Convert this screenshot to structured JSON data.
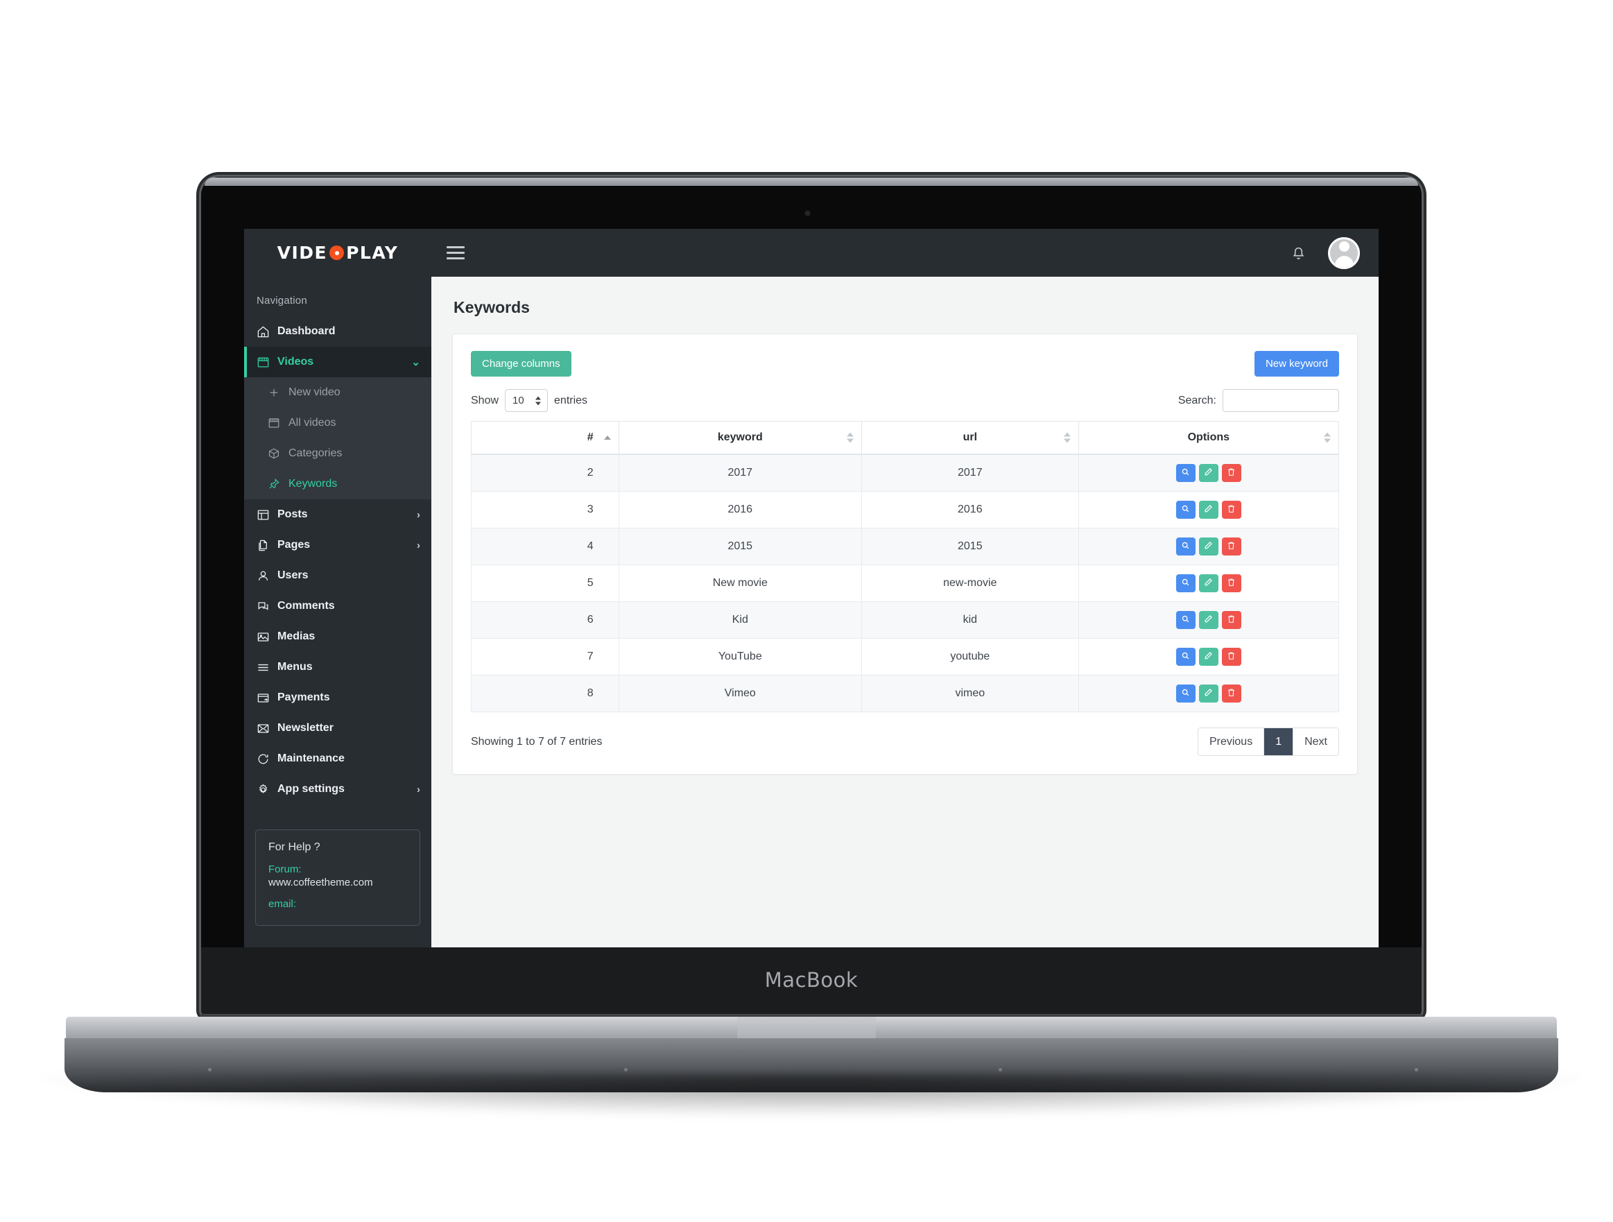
{
  "device": {
    "label": "MacBook"
  },
  "brand": {
    "part1": "VIDE",
    "part2": "PLAY"
  },
  "sidebar": {
    "nav_label": "Navigation",
    "items": [
      {
        "label": "Dashboard",
        "icon": "home-icon",
        "active": false,
        "arrow": ""
      },
      {
        "label": "Videos",
        "icon": "clapperboard-icon",
        "active": true,
        "arrow": "⌄"
      },
      {
        "label": "Posts",
        "icon": "layout-icon",
        "active": false,
        "arrow": "›"
      },
      {
        "label": "Pages",
        "icon": "pages-icon",
        "active": false,
        "arrow": "›"
      },
      {
        "label": "Users",
        "icon": "user-icon",
        "active": false,
        "arrow": ""
      },
      {
        "label": "Comments",
        "icon": "comments-icon",
        "active": false,
        "arrow": ""
      },
      {
        "label": "Medias",
        "icon": "image-icon",
        "active": false,
        "arrow": ""
      },
      {
        "label": "Menus",
        "icon": "menu-lines-icon",
        "active": false,
        "arrow": ""
      },
      {
        "label": "Payments",
        "icon": "payment-icon",
        "active": false,
        "arrow": ""
      },
      {
        "label": "Newsletter",
        "icon": "envelope-icon",
        "active": false,
        "arrow": ""
      },
      {
        "label": "Maintenance",
        "icon": "refresh-icon",
        "active": false,
        "arrow": ""
      },
      {
        "label": "App settings",
        "icon": "gear-icon",
        "active": false,
        "arrow": "›"
      }
    ],
    "submenu": [
      {
        "label": "New video",
        "icon": "plus-icon",
        "active": false
      },
      {
        "label": "All videos",
        "icon": "clapperboard-icon",
        "active": false
      },
      {
        "label": "Categories",
        "icon": "box-icon",
        "active": false
      },
      {
        "label": "Keywords",
        "icon": "pin-icon",
        "active": true
      }
    ],
    "help": {
      "title": "For Help ?",
      "forum_label": "Forum:",
      "forum_value": "www.coffeetheme.com",
      "email_label": "email:"
    }
  },
  "topbar": {
    "menu_toggle": "hamburger-icon",
    "bell": "bell-icon",
    "avatar": "user-avatar"
  },
  "page": {
    "title": "Keywords"
  },
  "toolbar": {
    "change_columns_label": "Change columns",
    "new_keyword_label": "New keyword"
  },
  "controls": {
    "show_label": "Show",
    "entries_label": "entries",
    "page_length": "10",
    "search_label": "Search:",
    "search_value": "",
    "search_placeholder": ""
  },
  "table": {
    "columns": [
      {
        "label": "#",
        "sort": "asc"
      },
      {
        "label": "keyword",
        "sort": "none"
      },
      {
        "label": "url",
        "sort": "none"
      },
      {
        "label": "Options",
        "sort": "none"
      }
    ],
    "rows": [
      {
        "num": "2",
        "keyword": "2017",
        "url": "2017"
      },
      {
        "num": "3",
        "keyword": "2016",
        "url": "2016"
      },
      {
        "num": "4",
        "keyword": "2015",
        "url": "2015"
      },
      {
        "num": "5",
        "keyword": "New movie",
        "url": "new-movie"
      },
      {
        "num": "6",
        "keyword": "Kid",
        "url": "kid"
      },
      {
        "num": "7",
        "keyword": "YouTube",
        "url": "youtube"
      },
      {
        "num": "8",
        "keyword": "Vimeo",
        "url": "vimeo"
      }
    ],
    "row_actions": [
      {
        "name": "view-button",
        "icon": "magnifier-icon"
      },
      {
        "name": "edit-button",
        "icon": "pencil-icon"
      },
      {
        "name": "delete-button",
        "icon": "trash-icon"
      }
    ]
  },
  "footer": {
    "showing": "Showing 1 to 7 of 7 entries",
    "pagination": [
      {
        "label": "Previous",
        "active": false
      },
      {
        "label": "1",
        "active": true
      },
      {
        "label": "Next",
        "active": false
      }
    ]
  },
  "colors": {
    "sidebar_bg": "#282d32",
    "accent_teal": "#35cfa1",
    "brand_orange": "#f4511e",
    "button_blue": "#4a8df0",
    "button_teal": "#4ab89a",
    "danger_red": "#f0544d",
    "pager_active": "#3f4a5a"
  }
}
